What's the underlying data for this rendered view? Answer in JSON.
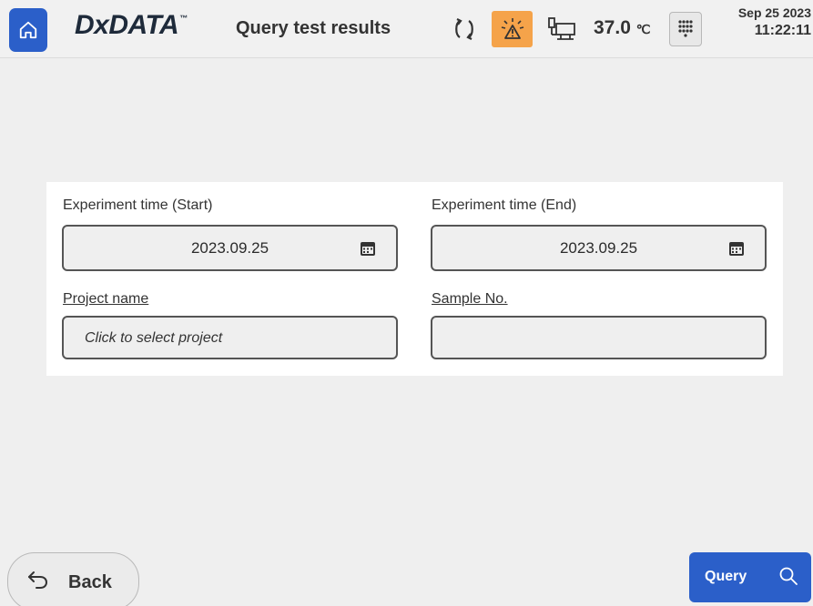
{
  "header": {
    "logo_text": "DxDATA",
    "logo_tm": "™",
    "title": "Query test results",
    "temperature_value": "37.0",
    "temperature_unit": "℃",
    "date": "Sep 25 2023",
    "time": "11:22:11"
  },
  "icons": {
    "home": "home-icon",
    "sync": "sync-icon",
    "alarm": "alarm-warning-icon",
    "instrument": "instrument-status-icon",
    "keypad": "keypad-icon",
    "calendar": "calendar-icon",
    "back": "back-arrow-icon",
    "search": "search-icon"
  },
  "colors": {
    "primary": "#2b5fc9",
    "alarm": "#f5a34a"
  },
  "form": {
    "start_label": "Experiment time (Start)",
    "start_value": "2023.09.25",
    "end_label": "Experiment time (End)",
    "end_value": "2023.09.25",
    "project_label": "Project name",
    "project_placeholder": "Click to select project",
    "sample_label": "Sample No.",
    "sample_value": ""
  },
  "footer": {
    "back_label": "Back",
    "query_label": "Query"
  }
}
